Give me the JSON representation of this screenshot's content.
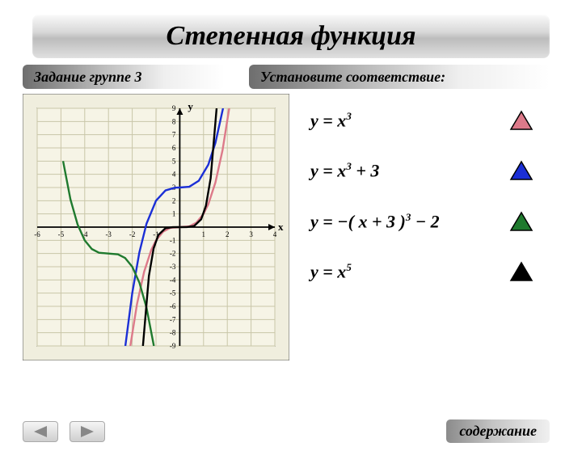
{
  "title": "Степенная функция",
  "subtitle_left": "Задание группе 3",
  "subtitle_right": "Установите соответствие:",
  "footer_link": "содержание",
  "axis": {
    "x_label": "х",
    "y_label": "у"
  },
  "equations": [
    {
      "latex_html": "y = x<sup>3</sup>",
      "color_swatch": "#dd7a8a"
    },
    {
      "latex_html": "y = x<sup>3</sup> + 3",
      "color_swatch": "#1b2fd6"
    },
    {
      "latex_html": "y = −( x + 3 )<sup>3</sup> − 2",
      "color_swatch": "#1f7a2e"
    },
    {
      "latex_html": "y = x<sup>5</sup>",
      "color_swatch": "#000000"
    }
  ],
  "chart_data": {
    "type": "line",
    "title": "",
    "xlabel": "x",
    "ylabel": "y",
    "xlim": [
      -6,
      4
    ],
    "ylim": [
      -9,
      9
    ],
    "x_ticks": [
      -6,
      -5,
      -4,
      -3,
      -2,
      -1,
      0,
      1,
      2,
      3,
      4
    ],
    "y_ticks": [
      -9,
      -8,
      -7,
      -6,
      -5,
      -4,
      -3,
      -2,
      -1,
      0,
      1,
      2,
      3,
      4,
      5,
      6,
      7,
      8,
      9
    ],
    "series": [
      {
        "name": "y = x^3",
        "color": "#dd7a8a",
        "x": [
          -2.08,
          -1.8,
          -1.5,
          -1.2,
          -1,
          -0.7,
          -0.4,
          0,
          0.4,
          0.7,
          1,
          1.2,
          1.5,
          1.8,
          2.08
        ],
        "y": [
          -9,
          -5.83,
          -3.38,
          -1.73,
          -1,
          -0.34,
          -0.06,
          0,
          0.06,
          0.34,
          1,
          1.73,
          3.38,
          5.83,
          9
        ]
      },
      {
        "name": "y = x^3 + 3",
        "color": "#1b2fd6",
        "x": [
          -2.29,
          -2,
          -1.7,
          -1.4,
          -1,
          -0.6,
          -0.2,
          0,
          0.4,
          0.8,
          1.2,
          1.5,
          1.82
        ],
        "y": [
          -9,
          -5,
          -1.91,
          0.26,
          2,
          2.78,
          2.99,
          3,
          3.06,
          3.51,
          4.73,
          6.38,
          9
        ]
      },
      {
        "name": "y = -(x+3)^3 - 2",
        "color": "#1f7a2e",
        "x": [
          -4.91,
          -4.6,
          -4.3,
          -4,
          -3.7,
          -3.4,
          -3,
          -2.6,
          -2.3,
          -2,
          -1.7,
          -1.4,
          -1.09
        ],
        "y": [
          5,
          2.1,
          0.2,
          -1,
          -1.66,
          -1.94,
          -2,
          -2.06,
          -2.34,
          -3,
          -4.2,
          -6.1,
          -9
        ]
      },
      {
        "name": "y = x^5",
        "color": "#000000",
        "x": [
          -1.55,
          -1.3,
          -1.1,
          -0.9,
          -0.6,
          -0.3,
          0,
          0.3,
          0.6,
          0.9,
          1.1,
          1.3,
          1.55
        ],
        "y": [
          -9,
          -3.71,
          -1.61,
          -0.59,
          -0.08,
          -0.002,
          0,
          0.002,
          0.08,
          0.59,
          1.61,
          3.71,
          9
        ]
      }
    ]
  }
}
